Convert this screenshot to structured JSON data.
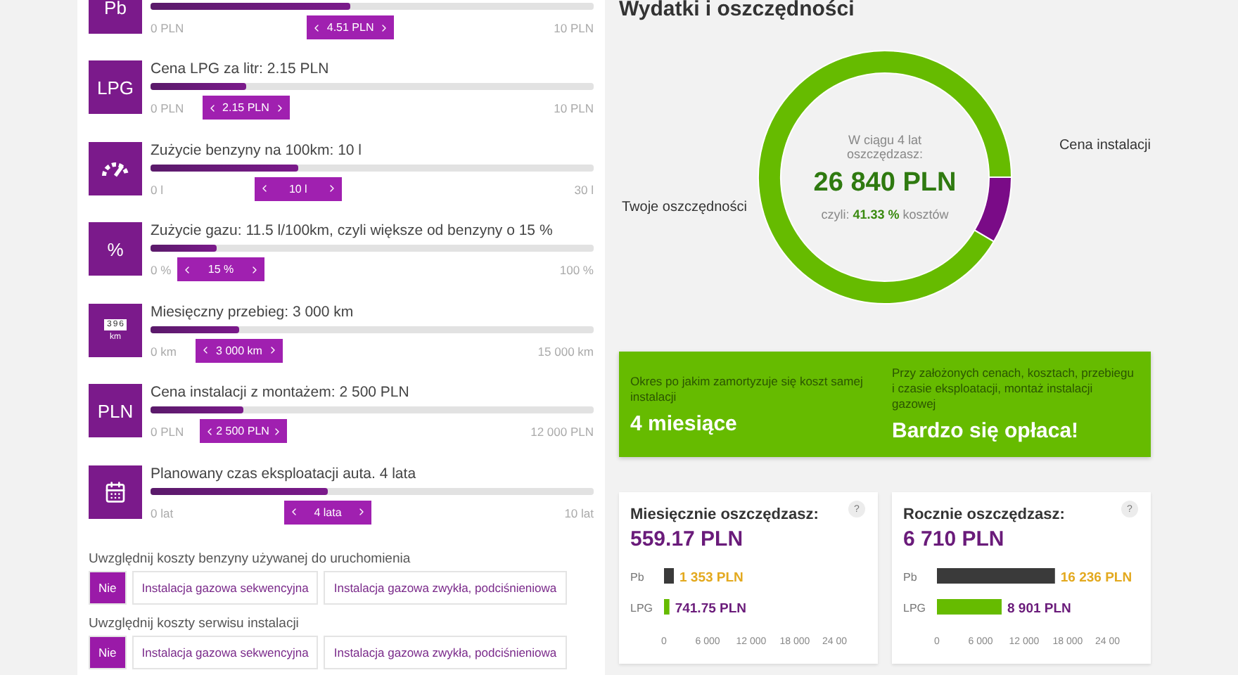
{
  "sliders": [
    {
      "icon": {
        "kind": "text",
        "text": "Pb"
      },
      "min": "0 PLN",
      "max": "10 PLN",
      "value": "4.51 PLN",
      "level": 0.451
    },
    {
      "icon": {
        "kind": "text",
        "text": "LPG"
      },
      "label": "Cena LPG za litr: 2.15 PLN",
      "min": "0 PLN",
      "max": "10 PLN",
      "value": "2.15 PLN",
      "level": 0.215
    },
    {
      "icon": {
        "kind": "gauge"
      },
      "label": "Zużycie benzyny na 100km: 10 l",
      "min": "0 l",
      "max": "30 l",
      "value": "10 l",
      "level": 0.333
    },
    {
      "icon": {
        "kind": "text",
        "text": "%"
      },
      "label": "Zużycie gazu: 11.5 l/100km, czyli większe od benzyny o 15 %",
      "min": "0 %",
      "max": "100 %",
      "value": "15 %",
      "level": 0.15
    },
    {
      "icon": {
        "kind": "odometer",
        "digits": [
          "3",
          "9",
          "6"
        ],
        "unit": "km"
      },
      "label": "Miesięczny przebieg: 3 000 km",
      "min": "0 km",
      "max": "15 000 km",
      "value": "3 000 km",
      "level": 0.2
    },
    {
      "icon": {
        "kind": "text",
        "text": "PLN"
      },
      "label": "Cena instalacji z montażem: 2 500 PLN",
      "min": "0 PLN",
      "max": "12 000 PLN",
      "value": "2 500 PLN",
      "level": 0.208
    },
    {
      "icon": {
        "kind": "calendar"
      },
      "label": "Planowany czas eksploatacji auta. 4 lata",
      "min": "0 lat",
      "max": "10 lat",
      "value": "4 lata",
      "level": 0.4
    }
  ],
  "option_groups": [
    {
      "label": "Uwzględnij koszty benzyny używanej do uruchomienia",
      "options": [
        {
          "label": "Nie",
          "selected": true
        },
        {
          "label": "Instalacja gazowa sekwencyjna",
          "selected": false
        },
        {
          "label": "Instalacja gazowa zwykła, podciśnieniowa",
          "selected": false
        }
      ]
    },
    {
      "label": "Uwzględnij koszty serwisu instalacji",
      "options": [
        {
          "label": "Nie",
          "selected": true
        },
        {
          "label": "Instalacja gazowa sekwencyjna",
          "selected": false
        },
        {
          "label": "Instalacja gazowa zwykła, podciśnieniowa",
          "selected": false
        }
      ]
    }
  ],
  "summary": {
    "title": "Wydatki i oszczędności",
    "donut": {
      "center_lines": [
        "W ciągu 4 lat",
        "oszczędzasz:"
      ],
      "amount": "26 840 PLN",
      "share_prefix": "czyli:",
      "share_value": "41.33 %",
      "share_suffix": "kosztów",
      "chart_data": {
        "type": "donut",
        "categories": [
          "Twoje oszczędności",
          "Cena instalacji"
        ],
        "values": [
          91.5,
          8.5
        ]
      }
    },
    "verdict": [
      {
        "caption": "Okres po jakim zamortyzuje się koszt samej instalacji",
        "value": "4 miesiące"
      },
      {
        "caption": "Przy założonych cenach, kosztach, przebiegu i czasie eksploatacji, montaż instalacji gazowej",
        "value": "Bardzo się opłaca!"
      }
    ],
    "cards": [
      {
        "title": "Miesięcznie oszczędzasz:",
        "amount": "559.17 PLN",
        "help": "?",
        "chart_data": {
          "type": "bar",
          "orientation": "horizontal",
          "categories": [
            "Pb",
            "LPG"
          ],
          "values": [
            1353,
            741.75
          ],
          "value_labels": [
            "1 353 PLN",
            "741.75 PLN"
          ],
          "xlim": [
            0,
            24000
          ],
          "xticks": [
            0,
            {
              "value": 6000,
              "label": "6 000"
            },
            {
              "value": 12000,
              "label": "12 000"
            },
            {
              "value": 18000,
              "label": "18 000"
            },
            {
              "value": 24000,
              "label": "24 00"
            }
          ]
        }
      },
      {
        "title": "Rocznie oszczędzasz:",
        "amount": "6 710 PLN",
        "help": "?",
        "chart_data": {
          "type": "bar",
          "orientation": "horizontal",
          "categories": [
            "Pb",
            "LPG"
          ],
          "values": [
            16236,
            8901
          ],
          "value_labels": [
            "16 236 PLN",
            "8 901 PLN"
          ],
          "xlim": [
            0,
            24000
          ],
          "xticks": [
            0,
            {
              "value": 6000,
              "label": "6 000"
            },
            {
              "value": 12000,
              "label": "12 000"
            },
            {
              "value": 18000,
              "label": "18 000"
            },
            {
              "value": 24000,
              "label": "24 00"
            }
          ]
        }
      }
    ]
  }
}
